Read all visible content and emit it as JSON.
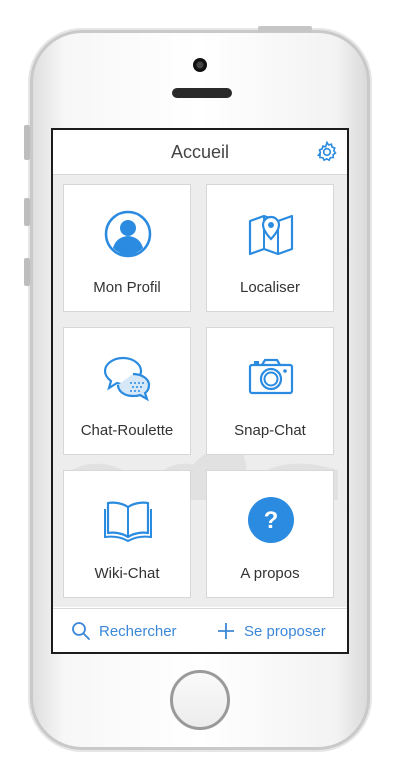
{
  "colors": {
    "accent": "#2b8be0",
    "tile_bg": "#ffffff",
    "grid_bg": "#ededed"
  },
  "header": {
    "title": "Accueil",
    "settings_icon": "gear-icon"
  },
  "tiles": [
    {
      "label": "Mon Profil",
      "icon": "user-icon"
    },
    {
      "label": "Localiser",
      "icon": "map-pin-icon"
    },
    {
      "label": "Chat-Roulette",
      "icon": "chat-bubbles-icon"
    },
    {
      "label": "Snap-Chat",
      "icon": "camera-icon"
    },
    {
      "label": "Wiki-Chat",
      "icon": "book-icon"
    },
    {
      "label": "A propos",
      "icon": "help-icon"
    }
  ],
  "footer": {
    "search_label": "Rechercher",
    "propose_label": "Se proposer"
  }
}
